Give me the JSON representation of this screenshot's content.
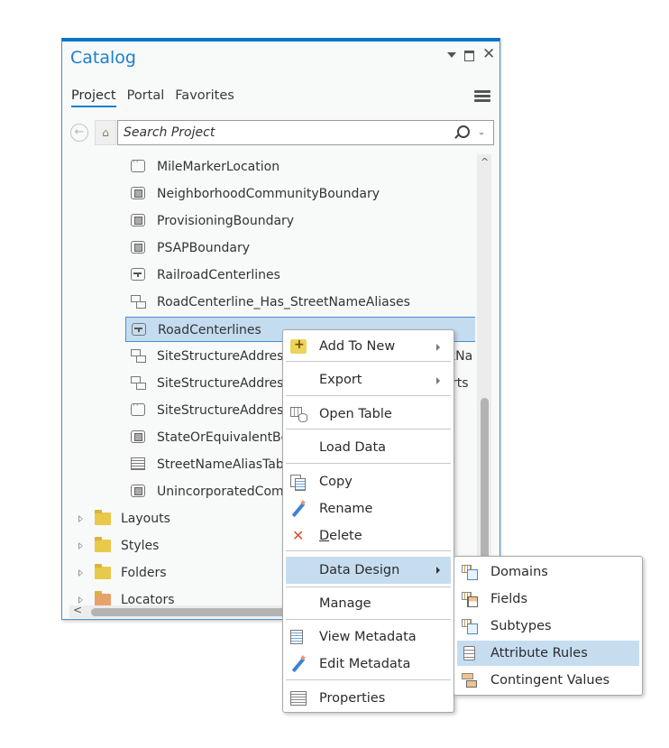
{
  "pane": {
    "title": "Catalog",
    "controls": {
      "pin_icon": "dropdown-triangle-icon",
      "maximize_icon": "maximize-icon",
      "close_icon": "close-icon",
      "close_glyph": "✕"
    },
    "tabs": [
      {
        "label": "Project",
        "active": true
      },
      {
        "label": "Portal",
        "active": false
      },
      {
        "label": "Favorites",
        "active": false
      }
    ],
    "menu_icon": "hamburger-menu-icon",
    "nav": {
      "back_glyph": "←",
      "home_glyph": "⌂",
      "search_placeholder": "Search Project",
      "search_value": ""
    },
    "tree": {
      "items": [
        {
          "label": "MileMarkerLocation",
          "type": "point",
          "icon": "point-feature-class-icon"
        },
        {
          "label": "NeighborhoodCommunityBoundary",
          "type": "polygon",
          "icon": "polygon-feature-class-icon"
        },
        {
          "label": "ProvisioningBoundary",
          "type": "polygon",
          "icon": "polygon-feature-class-icon"
        },
        {
          "label": "PSAPBoundary",
          "type": "polygon",
          "icon": "polygon-feature-class-icon"
        },
        {
          "label": "RailroadCenterlines",
          "type": "line",
          "icon": "line-feature-class-icon"
        },
        {
          "label": "RoadCenterline_Has_StreetNameAliases",
          "type": "relationship",
          "icon": "relationship-class-icon"
        },
        {
          "label": "RoadCenterlines",
          "type": "line",
          "icon": "line-feature-class-icon",
          "selected": true
        },
        {
          "label": "SiteStructureAddressPoint_Has_...kNa",
          "visible_left": "SiteStructureAddressI",
          "visible_right": "kNa",
          "type": "relationship",
          "icon": "relationship-class-icon"
        },
        {
          "label": "SiteStructureAddressPoint_...rts",
          "visible_left": "SiteStructureAddressI",
          "visible_right": "rts",
          "type": "relationship",
          "icon": "relationship-class-icon"
        },
        {
          "label": "SiteStructureAddressPoint",
          "visible_left": "SiteStructureAddressI",
          "type": "point",
          "icon": "point-feature-class-icon"
        },
        {
          "label": "StateOrEquivalentBoundary",
          "visible_left": "StateOrEquivalentBou",
          "type": "polygon",
          "icon": "polygon-feature-class-icon"
        },
        {
          "label": "StreetNameAliasTable",
          "visible_left": "StreetNameAliasTabl",
          "type": "table",
          "icon": "table-icon"
        },
        {
          "label": "UnincorporatedCommunityBoundary",
          "visible_left": "UnincorporatedComm",
          "type": "polygon",
          "icon": "polygon-feature-class-icon"
        }
      ],
      "folders": [
        {
          "label": "Layouts",
          "icon": "layouts-folder-icon"
        },
        {
          "label": "Styles",
          "icon": "styles-folder-icon"
        },
        {
          "label": "Folders",
          "icon": "folders-folder-icon"
        },
        {
          "label": "Locators",
          "icon": "locators-folder-icon"
        }
      ]
    },
    "scroll": {
      "up_glyph": "^",
      "left_glyph": "<"
    }
  },
  "context_menu": {
    "items": [
      {
        "label": "Add To New",
        "icon": "add-to-new-icon",
        "submenu": true
      },
      {
        "separator": true
      },
      {
        "label": "Export",
        "icon": "",
        "submenu": true
      },
      {
        "separator": true
      },
      {
        "label": "Open Table",
        "icon": "open-table-icon"
      },
      {
        "separator": true
      },
      {
        "label": "Load Data",
        "icon": ""
      },
      {
        "separator": true
      },
      {
        "label": "Copy",
        "icon": "copy-icon"
      },
      {
        "label": "Rename",
        "icon": "rename-pencil-icon"
      },
      {
        "label": "Delete",
        "icon": "delete-icon",
        "accelerator": "D"
      },
      {
        "separator": true
      },
      {
        "label": "Data Design",
        "icon": "",
        "submenu": true,
        "highlighted": true
      },
      {
        "separator": true
      },
      {
        "label": "Manage",
        "icon": ""
      },
      {
        "separator": true
      },
      {
        "label": "View Metadata",
        "icon": "view-metadata-icon"
      },
      {
        "label": "Edit Metadata",
        "icon": "edit-metadata-icon"
      },
      {
        "separator": true
      },
      {
        "label": "Properties",
        "icon": "properties-icon"
      }
    ]
  },
  "submenu": {
    "parent": "Data Design",
    "items": [
      {
        "label": "Domains",
        "icon": "domains-icon"
      },
      {
        "label": "Fields",
        "icon": "fields-icon"
      },
      {
        "label": "Subtypes",
        "icon": "subtypes-icon"
      },
      {
        "label": "Attribute Rules",
        "icon": "attribute-rules-icon",
        "highlighted": true
      },
      {
        "label": "Contingent Values",
        "icon": "contingent-values-icon"
      }
    ]
  },
  "colors": {
    "accent": "#0b73c9",
    "title_text": "#1b7fcf",
    "selection_bg": "#c4dcf0",
    "menu_highlight": "#c6ddf0",
    "delete_icon": "#d9542b",
    "folder_yellow": "#e9c94a"
  }
}
